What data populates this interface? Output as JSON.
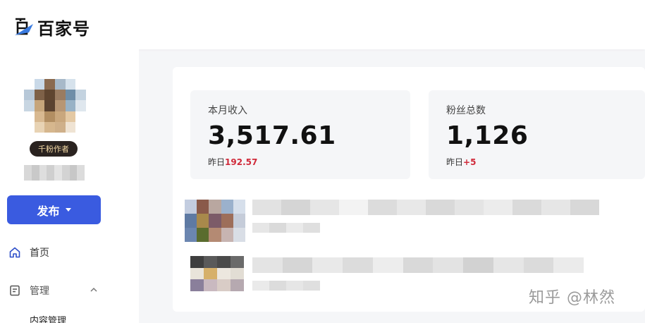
{
  "header": {
    "logo_text": "百家号",
    "logo_mark": "百"
  },
  "sidebar": {
    "author_badge": "千粉作者",
    "publish_label": "发布",
    "nav": [
      {
        "label": "首页",
        "icon": "home-icon"
      },
      {
        "label": "管理",
        "icon": "document-icon",
        "expanded": true
      }
    ],
    "sub_item": "内容管理"
  },
  "stats": [
    {
      "label": "本月收入",
      "value": "3,517.61",
      "sub_prefix": "昨日",
      "sub_value": "192.57"
    },
    {
      "label": "粉丝总数",
      "value": "1,126",
      "sub_prefix": "昨日",
      "sub_value": "+5"
    }
  ],
  "watermark": "知乎 @林然",
  "colors": {
    "accent": "#3a5be0",
    "positive": "#d02a3a",
    "badge_bg": "#2a2320",
    "badge_text": "#f1d7a4"
  }
}
